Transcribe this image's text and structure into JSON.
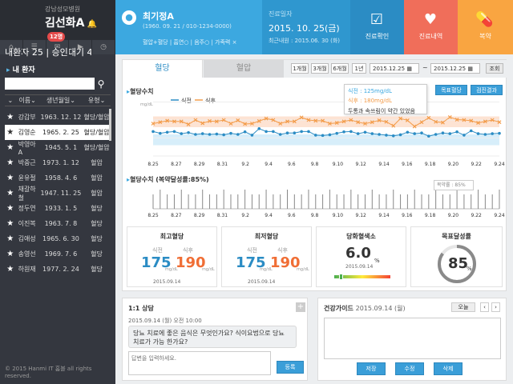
{
  "sidebar": {
    "hospital": "강남성모병원",
    "doctor": "김선화A",
    "badge": "12명",
    "counts": "내환자 25  |  승인대기 4",
    "icons": [
      "home",
      "list",
      "chat",
      "video",
      "clock"
    ],
    "title": "내 환자",
    "search_placeholder": "",
    "cols": [
      "이름",
      "생년월일",
      "유형"
    ],
    "patients": [
      {
        "name": "강갑부",
        "birth": "1963. 12. 12",
        "type": "혈당/혈압",
        "selected": false
      },
      {
        "name": "김영순",
        "birth": "1965. 2. 25",
        "type": "혈당/혈압",
        "selected": true
      },
      {
        "name": "박영아A",
        "birth": "1945. 5. 1",
        "type": "혈당/혈압",
        "selected": false
      },
      {
        "name": "박중근",
        "birth": "1973. 1. 12",
        "type": "혈압",
        "selected": false
      },
      {
        "name": "윤유절",
        "birth": "1958. 4. 6",
        "type": "혈압",
        "selected": false
      },
      {
        "name": "채갈하철",
        "birth": "1947. 11. 25",
        "type": "혈압",
        "selected": false
      },
      {
        "name": "정두연",
        "birth": "1933. 1. 5",
        "type": "혈당",
        "selected": false
      },
      {
        "name": "이진복",
        "birth": "1963. 7. 8",
        "type": "혈당",
        "selected": false
      },
      {
        "name": "김애성",
        "birth": "1965. 6. 30",
        "type": "혈당",
        "selected": false
      },
      {
        "name": "송영선",
        "birth": "1969. 7. 6",
        "type": "혈당",
        "selected": false
      },
      {
        "name": "하원재",
        "birth": "1977. 2. 24",
        "type": "혈당",
        "selected": false
      }
    ],
    "footer": "© 2015 Hanmi IT 홈블 all rights reserved."
  },
  "patient": {
    "name": "최기정A",
    "sub": "(1960. 09. 21 / 010-1234-0000)",
    "tags": "혈압+혈당 | 흡연○ | 음주○ | 가족력 ×"
  },
  "visit": {
    "label": "진료일자",
    "date": "2015. 10. 25(금)",
    "recent": "최근내원 : 2015.06. 30 (화)"
  },
  "top_buttons": {
    "confirm": "진료확인",
    "history": "진료내역",
    "drug": "복약"
  },
  "tabs": {
    "t1": "혈당",
    "t2": "혈압"
  },
  "periods": [
    "1개월",
    "3개월",
    "6개월",
    "1년"
  ],
  "date_from": "2015.12.25",
  "date_to": "2015.12.25",
  "query": "조회",
  "chart1": {
    "title": "혈당수치",
    "unit": "mg/dL",
    "legend": [
      "식전",
      "식후"
    ],
    "btn_target": "목표혈당",
    "btn_result": "검진결과"
  },
  "tooltip": {
    "l1": "식전 : 125mg/dL",
    "l2": "식후 : 180mg/dL",
    "l3": "두통과 속쓰림이 약간 있었음"
  },
  "chart2": {
    "title": "혈당수치 (복약달성률:85%)",
    "tip": "복약률 : 85%"
  },
  "colors": {
    "pre": "#2b8cc4",
    "post": "#f39c4a"
  },
  "chart_data": [
    {
      "type": "line",
      "title": "혈당수치",
      "ylabel": "mg/dL",
      "ylim": [
        100,
        260
      ],
      "categories": [
        "8.25",
        "8.27",
        "8.29",
        "8.31",
        "9.2",
        "9.4",
        "9.6",
        "9.8",
        "9.10",
        "9.12",
        "9.14",
        "9.16",
        "9.18",
        "9.20",
        "9.22",
        "9.24"
      ],
      "series": [
        {
          "name": "식전",
          "values": [
            168,
            163,
            166,
            168,
            162,
            165,
            160,
            162,
            160,
            161,
            159,
            163,
            160,
            167,
            158,
            176,
            168,
            168,
            160,
            164,
            164,
            168,
            168,
            158,
            157,
            159,
            163,
            167,
            168,
            162,
            166,
            162,
            160,
            158,
            156,
            159,
            166,
            162,
            164,
            155,
            160,
            164,
            162,
            167,
            158,
            170,
            162,
            160,
            162,
            163
          ]
        },
        {
          "name": "식후",
          "values": [
            190,
            194,
            198,
            196,
            196,
            188,
            200,
            191,
            197,
            196,
            200,
            190,
            199,
            189,
            190,
            197,
            204,
            200,
            190,
            196,
            196,
            207,
            200,
            198,
            198,
            190,
            192,
            196,
            200,
            194,
            190,
            194,
            199,
            195,
            184,
            204,
            199,
            182,
            194,
            206,
            195,
            193,
            208,
            201,
            200,
            198,
            192,
            196,
            200,
            194
          ]
        }
      ]
    },
    {
      "type": "bar",
      "title": "혈당수치 (복약달성률:85%)",
      "categories": [
        "8.25",
        "8.27",
        "8.29",
        "8.31",
        "9.2",
        "9.4",
        "9.6",
        "9.8",
        "9.10",
        "9.12",
        "9.14",
        "9.16",
        "9.18",
        "9.20",
        "9.22",
        "9.24"
      ]
    }
  ],
  "stats": {
    "max": {
      "title": "최고혈당",
      "pre_label": "식전",
      "post_label": "식후",
      "pre": "175",
      "post": "190",
      "unit": "mg/dL",
      "date": "2015.09.14"
    },
    "min": {
      "title": "최저혈당",
      "pre_label": "식전",
      "post_label": "식후",
      "pre": "175",
      "post": "190",
      "unit": "mg/dL",
      "date": "2015.09.14"
    },
    "a1c": {
      "title": "당화혈색소",
      "value": "6.0",
      "unit": "%",
      "date": "2015.09.14"
    },
    "goal": {
      "title": "목표달성률",
      "value": "85",
      "unit": "%",
      "pct": 0.85
    }
  },
  "consult": {
    "title": "1:1 상담",
    "meta": "2015.09.14 (월) 오전 10:00",
    "message": "당뇨 치료에 좋은 음식은 무엇인가요? 식이요법으로 당뇨 치료가 가능 한가요?",
    "placeholder": "답변을 입력하세요.",
    "submit": "등록"
  },
  "guide": {
    "title": "건강가이드",
    "date": "2015.09.14 (월)",
    "today": "오늘",
    "save": "저장",
    "edit": "수정",
    "del": "삭제"
  }
}
